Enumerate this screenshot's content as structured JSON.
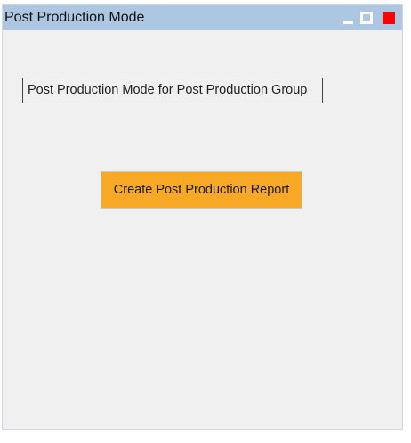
{
  "window": {
    "title": "Post Production Mode",
    "controls": {
      "minimize_icon": "minimize-icon",
      "maximize_icon": "maximize-icon",
      "close_icon": "close-icon"
    }
  },
  "main": {
    "group_label": "Post Production Mode for Post Production Group",
    "report_button_label": "Create Post Production Report"
  },
  "colors": {
    "titlebar": "#adc6e2",
    "window_background": "#f0f0f0",
    "button_accent": "#f7a825",
    "close_button": "#ff0000"
  }
}
